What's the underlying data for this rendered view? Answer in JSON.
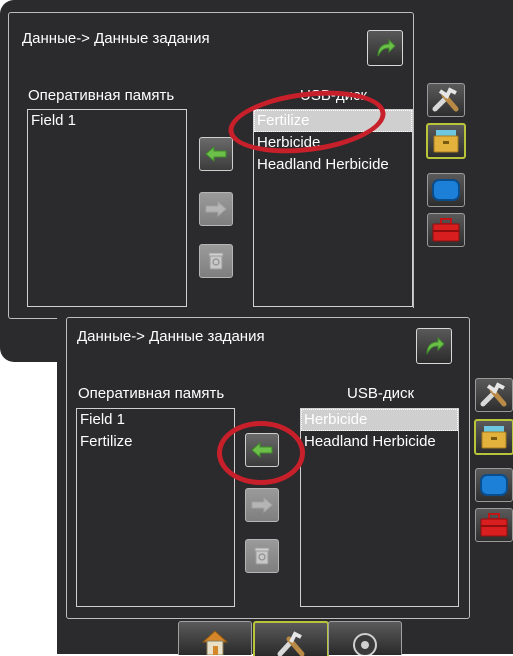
{
  "top": {
    "breadcrumb": "Данные-> Данные задания",
    "internal_label": "Оперативная память",
    "usb_label": "USB-диск",
    "internal_items": [
      "Field 1"
    ],
    "usb_items": [
      "Fertilize",
      "Herbicide",
      "Headland Herbicide"
    ],
    "usb_selected": "Fertilize"
  },
  "bottom": {
    "breadcrumb": "Данные-> Данные задания",
    "internal_label": "Оперативная память",
    "usb_label": "USB-диск",
    "internal_items": [
      "Field 1",
      "Fertilize"
    ],
    "usb_items": [
      "Herbicide",
      "Headland Herbicide"
    ],
    "usb_selected": "Herbicide"
  },
  "side_icons": [
    "tools-icon",
    "storage-drawer-icon",
    "display-icon",
    "toolbox-icon"
  ],
  "bottom_tabs": [
    "home-icon",
    "tools-icon",
    "speedometer-icon"
  ],
  "colors": {
    "background": "#2b2a2d",
    "highlight_ring": "#c8202a",
    "arrow_green": "#6cc04a",
    "active_border": "#b8c43a",
    "selection": "#d7d7d7"
  }
}
